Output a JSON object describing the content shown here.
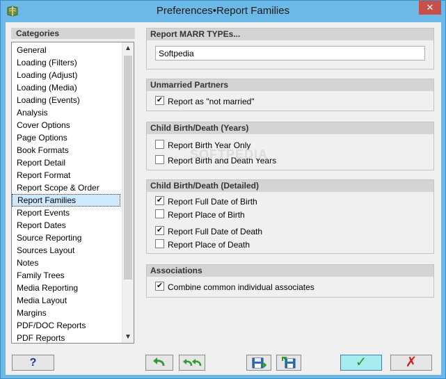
{
  "window": {
    "title": "Preferences•Report Families",
    "close_label": "✕"
  },
  "categories": {
    "header": "Categories",
    "items": [
      "General",
      "Loading (Filters)",
      "Loading (Adjust)",
      "Loading (Media)",
      "Loading (Events)",
      "Analysis",
      "Cover Options",
      "Page Options",
      "Book Formats",
      "Report Detail",
      "Report Format",
      "Report Scope & Order",
      "Report Families",
      "Report Events",
      "Report Dates",
      "Source Reporting",
      "Sources Layout",
      "Notes",
      "Family Trees",
      "Media Reporting",
      "Media Layout",
      "Margins",
      "PDF/DOC Reports",
      "PDF Reports"
    ],
    "selected": "Report Families",
    "scroll_up": "▲",
    "scroll_down": "▼"
  },
  "marr": {
    "header": "Report MARR TYPEs...",
    "value": "Softpedia"
  },
  "unmarried": {
    "header": "Unmarried Partners",
    "report_not_married": {
      "label": "Report as \"not married\"",
      "checked": true
    }
  },
  "years": {
    "header": "Child Birth/Death (Years)",
    "birth_year_only": {
      "label": "Report Birth Year Only",
      "checked": false
    },
    "birth_and_death_years": {
      "label": "Report Birth and Death Years",
      "checked": false
    }
  },
  "detailed": {
    "header": "Child Birth/Death (Detailed)",
    "full_date_birth": {
      "label": "Report Full Date of Birth",
      "checked": true
    },
    "place_birth": {
      "label": "Report Place of Birth",
      "checked": false
    },
    "full_date_death": {
      "label": "Report Full Date of Death",
      "checked": true
    },
    "place_death": {
      "label": "Report Place of Death",
      "checked": false
    }
  },
  "associations": {
    "header": "Associations",
    "combine": {
      "label": "Combine common individual associates",
      "checked": true
    }
  },
  "watermark": "SOFTPEDIA",
  "buttons": {
    "help": "?",
    "check_mark": "✓",
    "cross_mark": "✗"
  },
  "colors": {
    "ok_green": "#1aa11a",
    "cancel_red": "#d42020",
    "undo_green": "#2e9c2e",
    "save_blue": "#2d6fb5"
  }
}
